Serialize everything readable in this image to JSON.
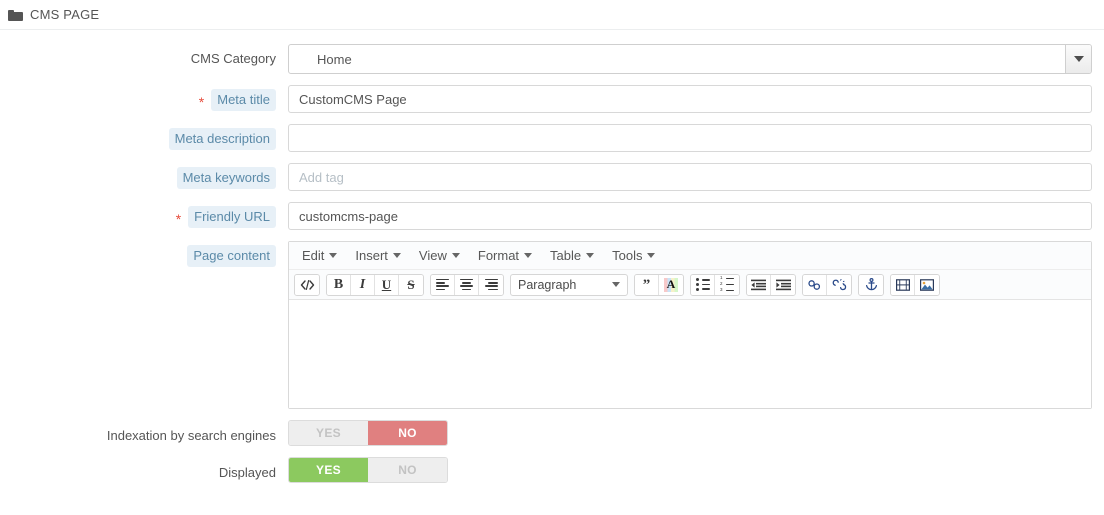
{
  "panel": {
    "title": "CMS PAGE",
    "icon": "folder-icon"
  },
  "form": {
    "fields": [
      {
        "label": "CMS Category",
        "label_style": "plain",
        "required": false,
        "type": "select",
        "value": "Home",
        "options": [
          "Home"
        ]
      },
      {
        "label": "Meta title",
        "label_style": "highlight",
        "required": true,
        "type": "text",
        "value": "CustomCMS Page",
        "placeholder": ""
      },
      {
        "label": "Meta description",
        "label_style": "highlight",
        "required": false,
        "type": "text",
        "value": "",
        "placeholder": ""
      },
      {
        "label": "Meta keywords",
        "label_style": "highlight",
        "required": false,
        "type": "text",
        "value": "",
        "placeholder": "Add tag"
      },
      {
        "label": "Friendly URL",
        "label_style": "highlight",
        "required": true,
        "type": "text",
        "value": "customcms-page",
        "placeholder": ""
      }
    ],
    "page_content": {
      "label": "Page content",
      "label_style": "highlight",
      "menubar": [
        "Edit",
        "Insert",
        "View",
        "Format",
        "Table",
        "Tools"
      ],
      "format_select": "Paragraph",
      "toolbar_icons": [
        "source-code-icon",
        "bold-icon",
        "italic-icon",
        "underline-icon",
        "strikethrough-icon",
        "align-left-icon",
        "align-center-icon",
        "align-right-icon",
        "blockquote-icon",
        "text-color-icon",
        "bullet-list-icon",
        "numbered-list-icon",
        "outdent-icon",
        "indent-icon",
        "link-icon",
        "unlink-icon",
        "anchor-icon",
        "media-icon",
        "image-icon"
      ],
      "body_text": ""
    },
    "toggles": [
      {
        "label": "Indexation by search engines",
        "yes_label": "YES",
        "no_label": "NO",
        "value": "NO"
      },
      {
        "label": "Displayed",
        "yes_label": "YES",
        "no_label": "NO",
        "value": "YES"
      }
    ]
  },
  "colors": {
    "toggle_on_yes": "#8cc95f",
    "toggle_on_no": "#e08080",
    "toggle_off_bg": "#eeeeee",
    "label_highlight_bg": "#e7f0f7",
    "label_highlight_text": "#5b8aa8",
    "required_star": "#e74c3c"
  }
}
